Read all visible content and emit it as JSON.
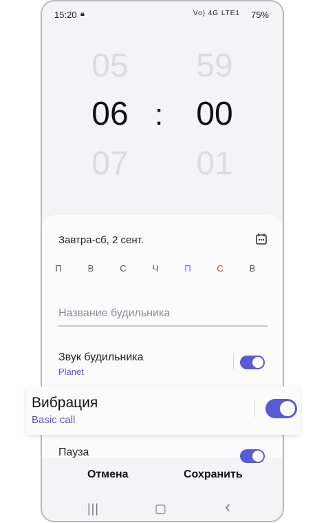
{
  "status_bar": {
    "time": "15:20",
    "lock_icon": "lock-icon",
    "network": "Vo) 4G LTE1",
    "battery": "75%"
  },
  "time_picker": {
    "hour_prev": "05",
    "hour": "06",
    "hour_next": "07",
    "separator": ":",
    "minute_prev": "59",
    "minute": "00",
    "minute_next": "01"
  },
  "alarm": {
    "date_label": "Завтра-сб, 2 сент.",
    "calendar_icon": "calendar-icon",
    "days": [
      {
        "label": "П",
        "color": "#555555"
      },
      {
        "label": "В",
        "color": "#555555"
      },
      {
        "label": "С",
        "color": "#555555"
      },
      {
        "label": "Ч",
        "color": "#555555"
      },
      {
        "label": "П",
        "color": "#4a6fd1"
      },
      {
        "label": "С",
        "color": "#d23a3a"
      },
      {
        "label": "В",
        "color": "#555555"
      }
    ],
    "name_placeholder": "Название будильника",
    "sound": {
      "title": "Звук будильника",
      "value": "Planet",
      "enabled": true
    },
    "vibration": {
      "title": "Вибрация",
      "value": "Basic call",
      "enabled": true
    },
    "snooze": {
      "title": "Пауза",
      "enabled": true
    }
  },
  "actions": {
    "cancel": "Отмена",
    "save": "Сохранить"
  },
  "nav": {
    "recents": "|||",
    "home": "▢",
    "back": "‹"
  },
  "colors": {
    "accent": "#5a5ad6",
    "subtitle": "#5957c9"
  }
}
